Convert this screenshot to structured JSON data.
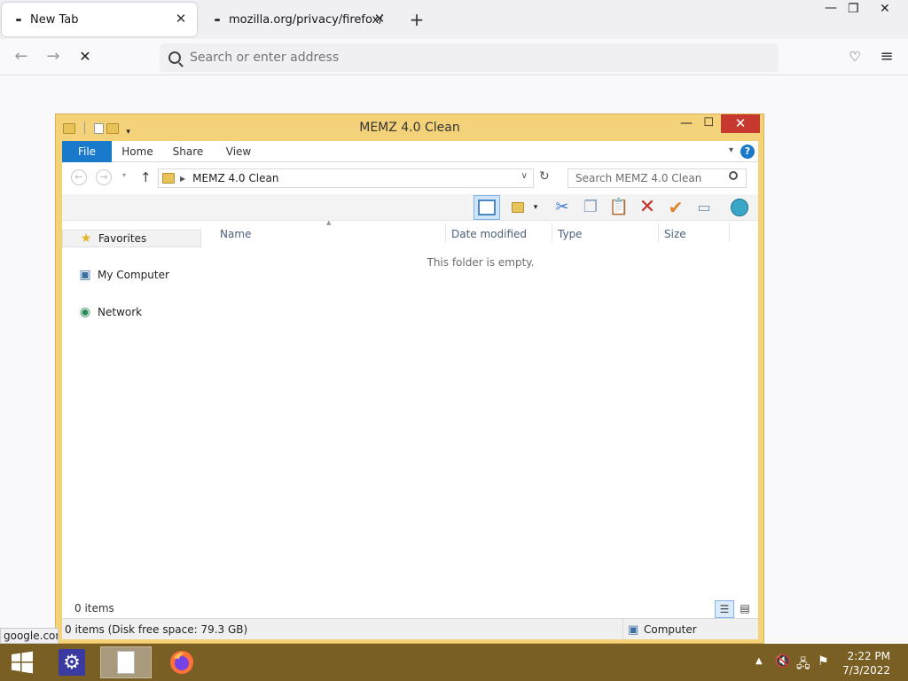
{
  "browser": {
    "tabs": [
      {
        "label": "New Tab",
        "active": true
      },
      {
        "label": "mozilla.org/privacy/firefox/",
        "active": false
      }
    ],
    "new_tab_symbol": "+",
    "address_placeholder": "Search or enter address",
    "status_url": "google.com"
  },
  "explorer": {
    "title": "MEMZ 4.0 Clean",
    "ribbon_tabs": [
      "File",
      "Home",
      "Share",
      "View"
    ],
    "breadcrumb": "MEMZ 4.0 Clean",
    "search_placeholder": "Search MEMZ 4.0 Clean",
    "nav": {
      "favorites": "Favorites",
      "computer": "My Computer",
      "network": "Network"
    },
    "columns": [
      "Name",
      "Date modified",
      "Type",
      "Size"
    ],
    "empty_message": "This folder is empty.",
    "item_count": "0 items",
    "status_left": "0 items (Disk free space: 79.3 GB)",
    "status_right": "Computer"
  },
  "taskbar": {
    "time": "2:22 PM",
    "date": "7/3/2022"
  },
  "colors": {
    "accent": "#1979ca",
    "window_frame": "#f4d27a",
    "close_button": "#c7392f",
    "taskbar": "#7a5f24"
  }
}
